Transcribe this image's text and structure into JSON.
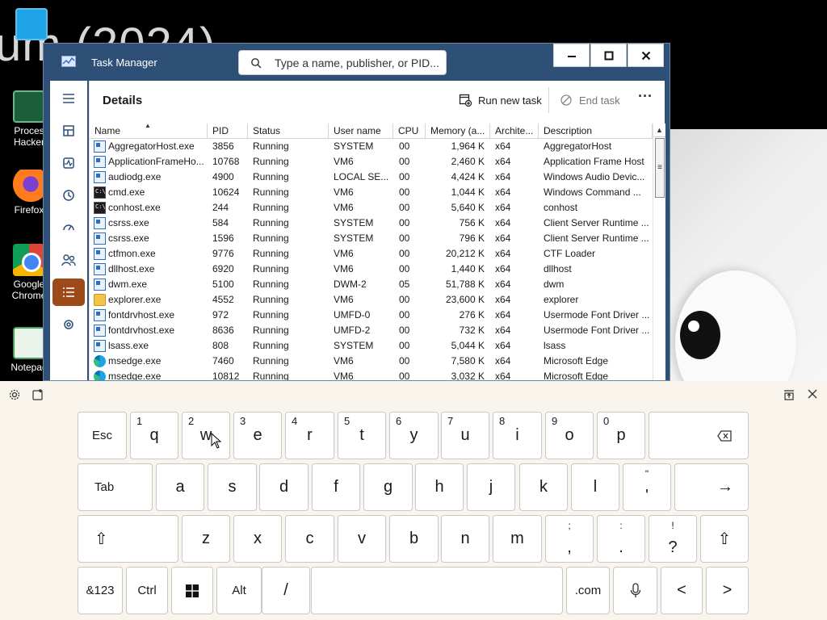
{
  "desktop": {
    "background_text": "um (2024)",
    "icons": [
      {
        "label": "",
        "kind": "monitor"
      },
      {
        "label": "Proces\nHacker",
        "kind": "process-hacker"
      },
      {
        "label": "Firefox",
        "kind": "firefox"
      },
      {
        "label": "Google Chrome",
        "kind": "chrome"
      },
      {
        "label": "Notepad",
        "kind": "notepad"
      }
    ]
  },
  "task_manager": {
    "title": "Task Manager",
    "search_placeholder": "Type a name, publisher, or PID...",
    "window_controls": {
      "minimize": "—",
      "maximize": "☐",
      "close": "✕"
    },
    "page_title": "Details",
    "toolbar": {
      "run_task": "Run new task",
      "end_task": "End task",
      "more": "···"
    },
    "columns": [
      "Name",
      "PID",
      "Status",
      "User name",
      "CPU",
      "Memory (a...",
      "Archite...",
      "Description"
    ],
    "rows": [
      {
        "icon": "std",
        "name": "AggregatorHost.exe",
        "pid": "3856",
        "status": "Running",
        "user": "SYSTEM",
        "cpu": "00",
        "mem": "1,964 K",
        "arch": "x64",
        "desc": "AggregatorHost"
      },
      {
        "icon": "std",
        "name": "ApplicationFrameHo...",
        "pid": "10768",
        "status": "Running",
        "user": "VM6",
        "cpu": "00",
        "mem": "2,460 K",
        "arch": "x64",
        "desc": "Application Frame Host"
      },
      {
        "icon": "std",
        "name": "audiodg.exe",
        "pid": "4900",
        "status": "Running",
        "user": "LOCAL SE...",
        "cpu": "00",
        "mem": "4,424 K",
        "arch": "x64",
        "desc": "Windows Audio Devic..."
      },
      {
        "icon": "cmd",
        "name": "cmd.exe",
        "pid": "10624",
        "status": "Running",
        "user": "VM6",
        "cpu": "00",
        "mem": "1,044 K",
        "arch": "x64",
        "desc": "Windows Command ..."
      },
      {
        "icon": "cmd",
        "name": "conhost.exe",
        "pid": "244",
        "status": "Running",
        "user": "VM6",
        "cpu": "00",
        "mem": "5,640 K",
        "arch": "x64",
        "desc": "conhost"
      },
      {
        "icon": "std",
        "name": "csrss.exe",
        "pid": "584",
        "status": "Running",
        "user": "SYSTEM",
        "cpu": "00",
        "mem": "756 K",
        "arch": "x64",
        "desc": "Client Server Runtime ..."
      },
      {
        "icon": "std",
        "name": "csrss.exe",
        "pid": "1596",
        "status": "Running",
        "user": "SYSTEM",
        "cpu": "00",
        "mem": "796 K",
        "arch": "x64",
        "desc": "Client Server Runtime ..."
      },
      {
        "icon": "std",
        "name": "ctfmon.exe",
        "pid": "9776",
        "status": "Running",
        "user": "VM6",
        "cpu": "00",
        "mem": "20,212 K",
        "arch": "x64",
        "desc": "CTF Loader"
      },
      {
        "icon": "std",
        "name": "dllhost.exe",
        "pid": "6920",
        "status": "Running",
        "user": "VM6",
        "cpu": "00",
        "mem": "1,440 K",
        "arch": "x64",
        "desc": "dllhost"
      },
      {
        "icon": "std",
        "name": "dwm.exe",
        "pid": "5100",
        "status": "Running",
        "user": "DWM-2",
        "cpu": "05",
        "mem": "51,788 K",
        "arch": "x64",
        "desc": "dwm"
      },
      {
        "icon": "folder",
        "name": "explorer.exe",
        "pid": "4552",
        "status": "Running",
        "user": "VM6",
        "cpu": "00",
        "mem": "23,600 K",
        "arch": "x64",
        "desc": "explorer"
      },
      {
        "icon": "std",
        "name": "fontdrvhost.exe",
        "pid": "972",
        "status": "Running",
        "user": "UMFD-0",
        "cpu": "00",
        "mem": "276 K",
        "arch": "x64",
        "desc": "Usermode Font Driver ..."
      },
      {
        "icon": "std",
        "name": "fontdrvhost.exe",
        "pid": "8636",
        "status": "Running",
        "user": "UMFD-2",
        "cpu": "00",
        "mem": "732 K",
        "arch": "x64",
        "desc": "Usermode Font Driver ..."
      },
      {
        "icon": "std",
        "name": "lsass.exe",
        "pid": "808",
        "status": "Running",
        "user": "SYSTEM",
        "cpu": "00",
        "mem": "5,044 K",
        "arch": "x64",
        "desc": "lsass"
      },
      {
        "icon": "edge",
        "name": "msedge.exe",
        "pid": "7460",
        "status": "Running",
        "user": "VM6",
        "cpu": "00",
        "mem": "7,580 K",
        "arch": "x64",
        "desc": "Microsoft Edge"
      },
      {
        "icon": "edge",
        "name": "msedge.exe",
        "pid": "10812",
        "status": "Running",
        "user": "VM6",
        "cpu": "00",
        "mem": "3,032 K",
        "arch": "x64",
        "desc": "Microsoft Edge"
      }
    ],
    "sidebar": [
      "menu-icon",
      "processes-icon",
      "performance-icon",
      "app-history-icon",
      "startup-apps-icon",
      "users-icon",
      "details-icon",
      "services-icon"
    ],
    "accent_color": "#9c4a19"
  },
  "keyboard": {
    "row1": [
      {
        "label": "Esc"
      },
      {
        "label": "q",
        "num": "1"
      },
      {
        "label": "w",
        "num": "2"
      },
      {
        "label": "e",
        "num": "3"
      },
      {
        "label": "r",
        "num": "4"
      },
      {
        "label": "t",
        "num": "5"
      },
      {
        "label": "y",
        "num": "6"
      },
      {
        "label": "u",
        "num": "7"
      },
      {
        "label": "i",
        "num": "8"
      },
      {
        "label": "o",
        "num": "9"
      },
      {
        "label": "p",
        "num": "0"
      },
      {
        "label": "⌫"
      }
    ],
    "row2": [
      {
        "label": "Tab"
      },
      {
        "label": "a"
      },
      {
        "label": "s"
      },
      {
        "label": "d"
      },
      {
        "label": "f"
      },
      {
        "label": "g"
      },
      {
        "label": "h"
      },
      {
        "label": "j"
      },
      {
        "label": "k"
      },
      {
        "label": "l"
      },
      {
        "top": "\"",
        "bottom": "'"
      },
      {
        "label": "→"
      }
    ],
    "row3": [
      {
        "label": "⇧"
      },
      {
        "label": "z"
      },
      {
        "label": "x"
      },
      {
        "label": "c"
      },
      {
        "label": "v"
      },
      {
        "label": "b"
      },
      {
        "label": "n"
      },
      {
        "label": "m"
      },
      {
        "top": ";",
        "bottom": ","
      },
      {
        "top": ":",
        "bottom": "."
      },
      {
        "top": "!",
        "bottom": "?"
      },
      {
        "label": "⇧"
      }
    ],
    "row4": [
      {
        "label": "&123"
      },
      {
        "label": "Ctrl"
      },
      {
        "label": "win"
      },
      {
        "label": "Alt"
      },
      {
        "label": "/"
      },
      {
        "label": ""
      },
      {
        "label": ".com"
      },
      {
        "label": "mic"
      },
      {
        "label": "<"
      },
      {
        "label": ">"
      }
    ]
  }
}
